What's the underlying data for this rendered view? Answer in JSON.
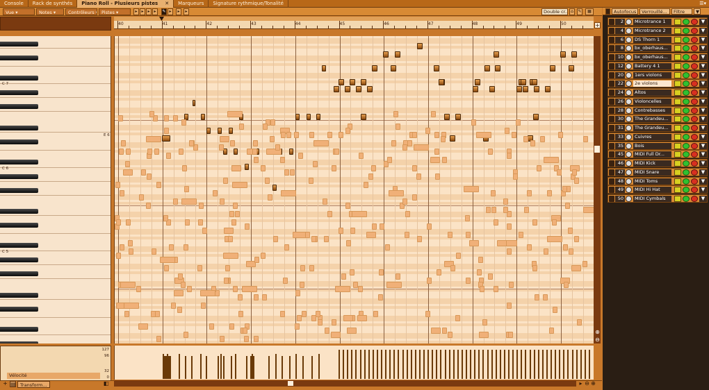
{
  "tabs": [
    {
      "label": "Console"
    },
    {
      "label": "Rack de synthés"
    },
    {
      "label": "Piano Roll - Plusieurs pistes",
      "active": true,
      "close": "✕"
    },
    {
      "label": "Marqueurs"
    },
    {
      "label": "Signature rythmique/Tonalité"
    }
  ],
  "tab_menu": "☰▾",
  "toolbar": {
    "vue": "Vue",
    "notes": "Notes",
    "controleurs": "Contrôleurs",
    "pistes": "Pistes",
    "snap": "Double cr..."
  },
  "ruler": {
    "measures": [
      "40",
      "41",
      "42",
      "43",
      "44",
      "45",
      "46",
      "47",
      "48",
      "49",
      "50"
    ]
  },
  "keyboard": {
    "labels": [
      "C 7",
      "E 6",
      "C 6",
      "C 5"
    ]
  },
  "velocity": {
    "label": "Vélocité",
    "scale": [
      "127",
      "96",
      "32",
      "0"
    ]
  },
  "bottom": {
    "transform": "Transform...",
    "add": "+"
  },
  "track_panel": {
    "autofocus": "Autofocus",
    "verrouille": "Verrouillé...",
    "filtre": "Filtre",
    "tracks": [
      {
        "num": "2",
        "name": "Microtrance 1"
      },
      {
        "num": "4",
        "name": "Microtrance 2"
      },
      {
        "num": "6",
        "name": "DS Thorn 1"
      },
      {
        "num": "8",
        "name": "bx_oberhaus..."
      },
      {
        "num": "10",
        "name": "bx_oberhaus..."
      },
      {
        "num": "12",
        "name": "Battery 4 1"
      },
      {
        "num": "20",
        "name": "1ers violons"
      },
      {
        "num": "22",
        "name": "2e violons",
        "selected": true
      },
      {
        "num": "24",
        "name": "Altos"
      },
      {
        "num": "26",
        "name": "Violoncelles"
      },
      {
        "num": "28",
        "name": "Contrebasses"
      },
      {
        "num": "30",
        "name": "The Grandeu..."
      },
      {
        "num": "31",
        "name": "The Grandeu..."
      },
      {
        "num": "33",
        "name": "Cuivres"
      },
      {
        "num": "35",
        "name": "Bois"
      },
      {
        "num": "45",
        "name": "MIDI Full Dr..."
      },
      {
        "num": "46",
        "name": "MIDI Kick"
      },
      {
        "num": "47",
        "name": "MIDI Snare"
      },
      {
        "num": "48",
        "name": "MIDI Toms"
      },
      {
        "num": "49",
        "name": "MIDI Hi Hat"
      },
      {
        "num": "50",
        "name": "MIDI Cymbals"
      }
    ]
  },
  "colors": {
    "accent": "#d88a34",
    "grid_bg": "#fbe3c6",
    "active_note": "#8a4a10",
    "ghost_note": "#f0b078"
  }
}
